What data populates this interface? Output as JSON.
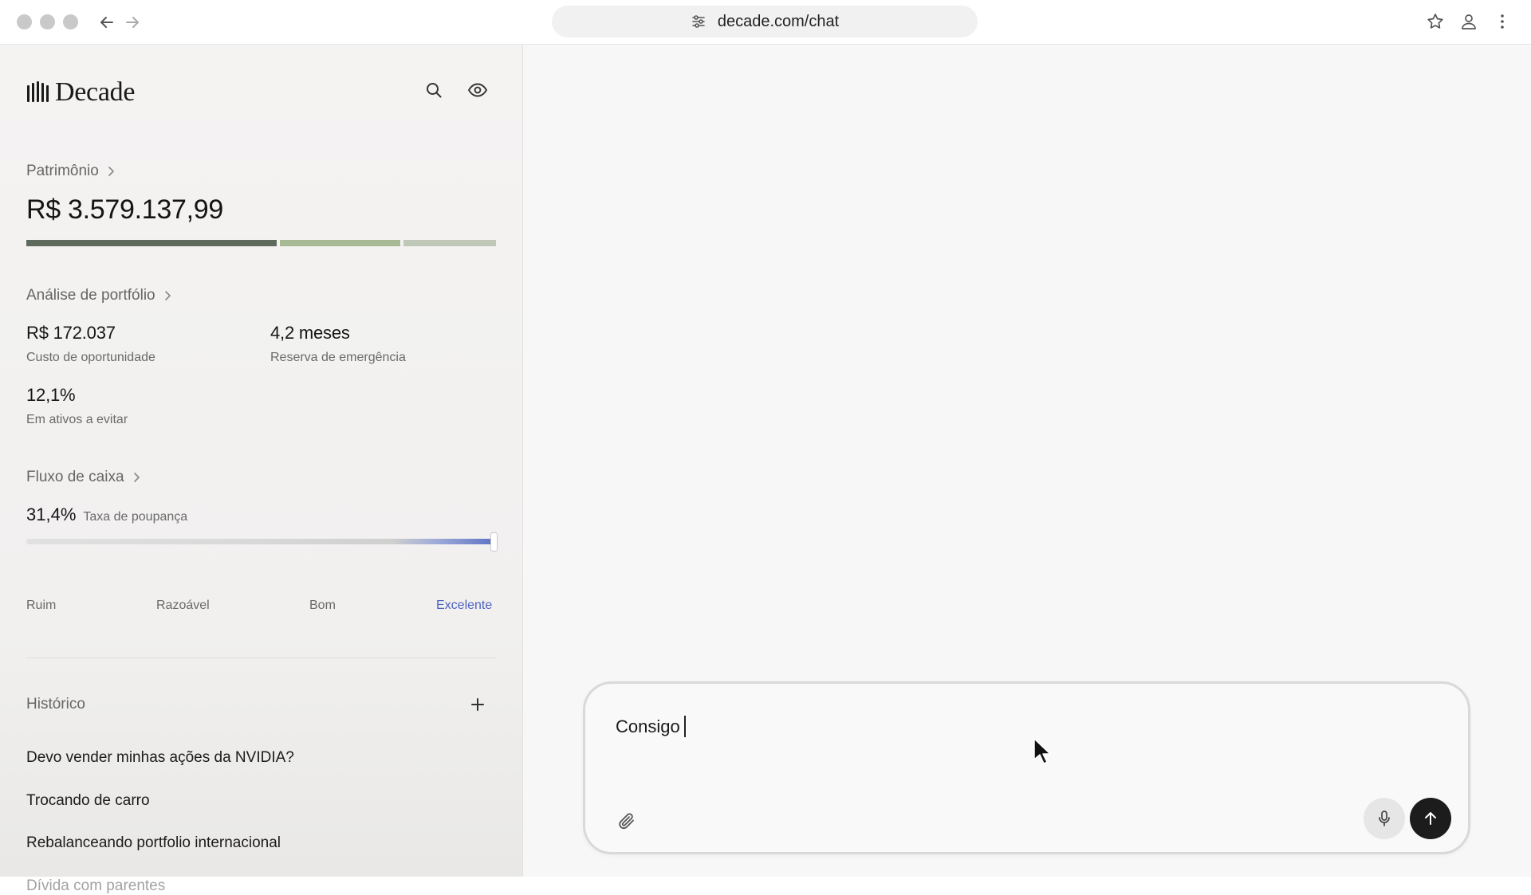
{
  "browser": {
    "url": "decade.com/chat",
    "icons": [
      "back-arrow-icon",
      "forward-arrow-icon",
      "site-settings-icon",
      "star-icon",
      "profile-icon",
      "more-vertical-icon"
    ]
  },
  "sidebar": {
    "brand": "Decade",
    "patrimonio": {
      "title": "Patrimônio",
      "value": "R$ 3.579.137,99",
      "allocation": [
        {
          "share": 0.54,
          "color": "#5e6a5b"
        },
        {
          "share": 0.26,
          "color": "#a7ba94"
        },
        {
          "share": 0.2,
          "color": "#bfc8b6"
        }
      ]
    },
    "portfolio": {
      "title": "Análise de portfólio",
      "metrics": [
        {
          "value": "R$ 172.037",
          "label": "Custo de oportunidade"
        },
        {
          "value": "4,2 meses",
          "label": "Reserva de emergência"
        },
        {
          "value": "12,1%",
          "label": "Em ativos a evitar"
        }
      ]
    },
    "cashflow": {
      "title": "Fluxo de caixa",
      "savings_value": "31,4%",
      "savings_label": "Taxa de poupança",
      "level": 1.0,
      "scale": [
        "Ruim",
        "Razoável",
        "Bom",
        "Excelente"
      ],
      "active_color": "#4d63c0"
    },
    "history": {
      "title": "Histórico",
      "items": [
        "Devo vender minhas ações da NVIDIA?",
        "Trocando de carro",
        "Rebalanceando portfolio internacional",
        "Dívida com parentes"
      ]
    }
  },
  "composer": {
    "text": "Consigo"
  }
}
